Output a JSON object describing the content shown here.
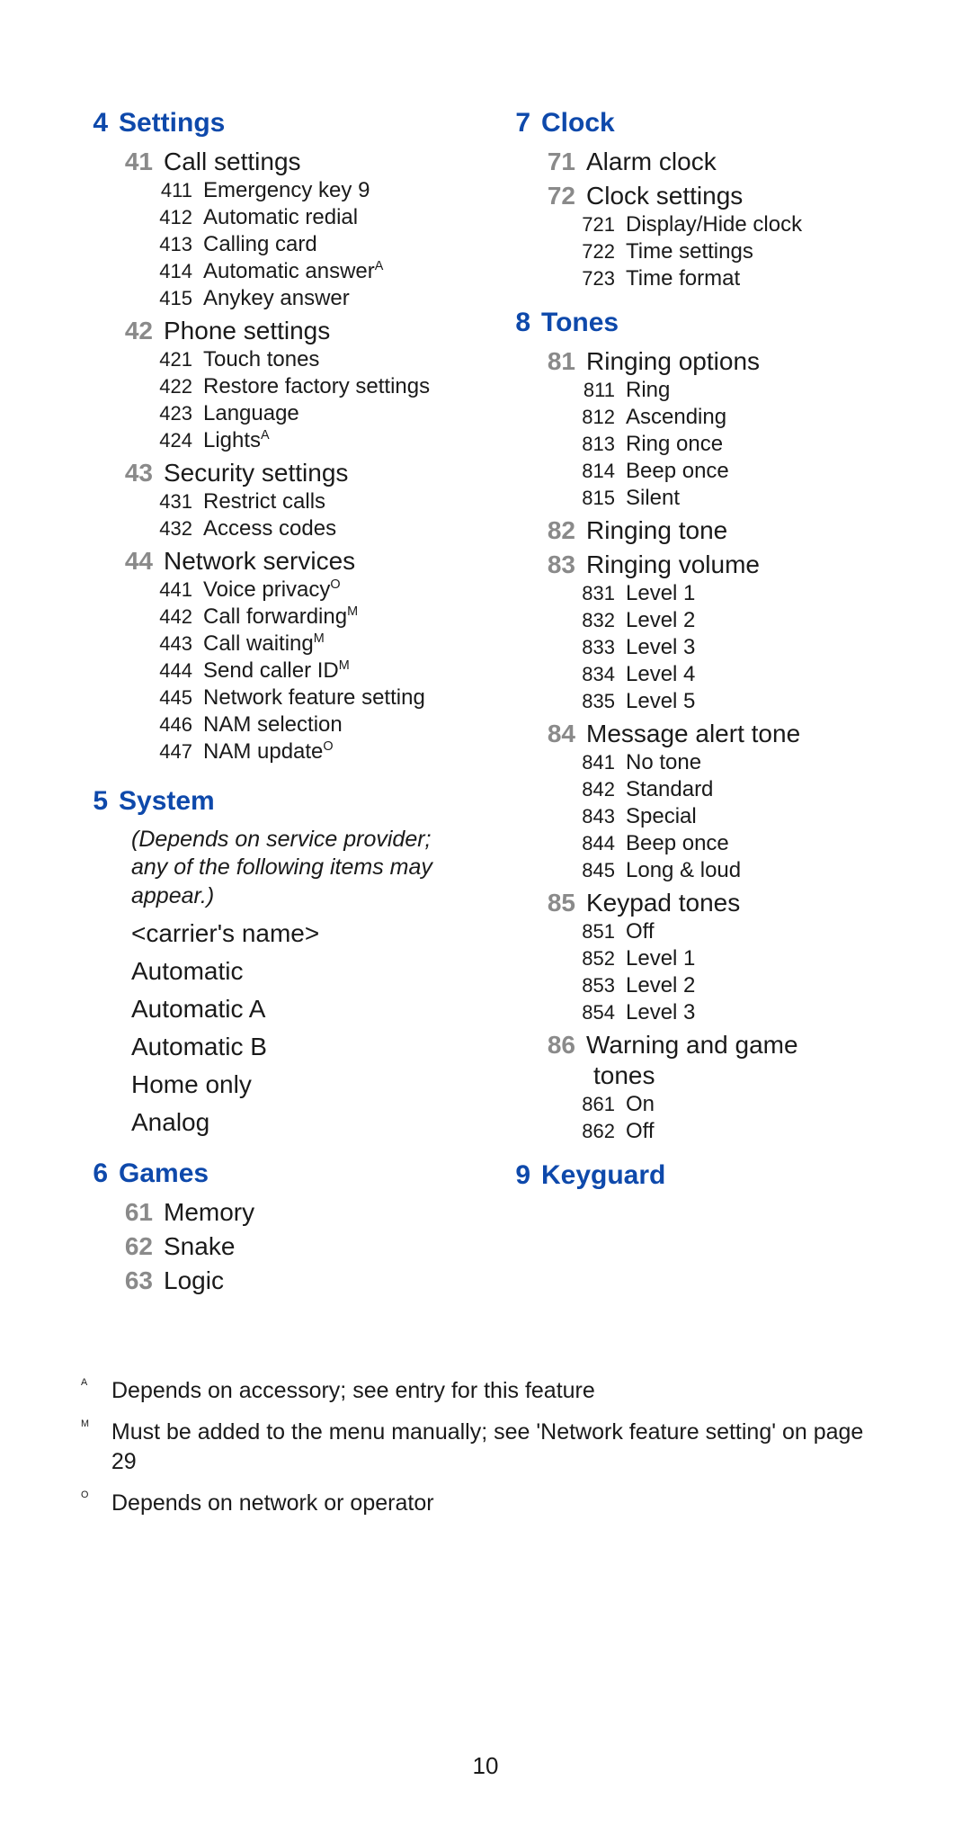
{
  "pageNumber": "10",
  "footnotes": {
    "A": {
      "marker": "A",
      "text": "Depends on accessory; see entry for this feature"
    },
    "M": {
      "marker": "M",
      "text": "Must be added to the menu manually; see 'Network feature setting' on page 29"
    },
    "O": {
      "marker": "O",
      "text": "Depends on network or operator"
    }
  },
  "sec4": {
    "num": "4",
    "title": "Settings",
    "s41": {
      "num": "41",
      "title": "Call settings",
      "i411": {
        "num": "411",
        "title": "Emergency key 9"
      },
      "i412": {
        "num": "412",
        "title": "Automatic redial"
      },
      "i413": {
        "num": "413",
        "title": "Calling card"
      },
      "i414": {
        "num": "414",
        "title": "Automatic answer",
        "sup": "A"
      },
      "i415": {
        "num": "415",
        "title": "Anykey answer"
      }
    },
    "s42": {
      "num": "42",
      "title": "Phone settings",
      "i421": {
        "num": "421",
        "title": "Touch tones"
      },
      "i422": {
        "num": "422",
        "title": "Restore factory settings"
      },
      "i423": {
        "num": "423",
        "title": "Language"
      },
      "i424": {
        "num": "424",
        "title": "Lights",
        "sup": "A"
      }
    },
    "s43": {
      "num": "43",
      "title": "Security settings",
      "i431": {
        "num": "431",
        "title": "Restrict calls"
      },
      "i432": {
        "num": "432",
        "title": "Access codes"
      }
    },
    "s44": {
      "num": "44",
      "title": "Network services",
      "i441": {
        "num": "441",
        "title": "Voice privacy",
        "sup": "O"
      },
      "i442": {
        "num": "442",
        "title": "Call forwarding",
        "sup": "M"
      },
      "i443": {
        "num": "443",
        "title": "Call waiting",
        "sup": "M"
      },
      "i444": {
        "num": "444",
        "title": "Send caller ID",
        "sup": "M"
      },
      "i445": {
        "num": "445",
        "title": "Network feature setting"
      },
      "i446": {
        "num": "446",
        "title": "NAM selection"
      },
      "i447": {
        "num": "447",
        "title": "NAM update",
        "sup": "O"
      }
    }
  },
  "sec5": {
    "num": "5",
    "title": "System",
    "note": "(Depends on service provider; any of the following items may appear.)",
    "opts": {
      "a": "<carrier's name>",
      "b": "Automatic",
      "c": "Automatic A",
      "d": "Automatic B",
      "e": "Home only",
      "f": "Analog"
    }
  },
  "sec6": {
    "num": "6",
    "title": "Games",
    "s61": {
      "num": "61",
      "title": "Memory"
    },
    "s62": {
      "num": "62",
      "title": "Snake"
    },
    "s63": {
      "num": "63",
      "title": "Logic"
    }
  },
  "sec7": {
    "num": "7",
    "title": "Clock",
    "s71": {
      "num": "71",
      "title": "Alarm clock"
    },
    "s72": {
      "num": "72",
      "title": "Clock settings",
      "i721": {
        "num": "721",
        "title": "Display/Hide clock"
      },
      "i722": {
        "num": "722",
        "title": "Time settings"
      },
      "i723": {
        "num": "723",
        "title": "Time format"
      }
    }
  },
  "sec8": {
    "num": "8",
    "title": "Tones",
    "s81": {
      "num": "81",
      "title": "Ringing options",
      "i811": {
        "num": "811",
        "title": "Ring"
      },
      "i812": {
        "num": "812",
        "title": "Ascending"
      },
      "i813": {
        "num": "813",
        "title": "Ring once"
      },
      "i814": {
        "num": "814",
        "title": "Beep once"
      },
      "i815": {
        "num": "815",
        "title": "Silent"
      }
    },
    "s82": {
      "num": "82",
      "title": "Ringing tone"
    },
    "s83": {
      "num": "83",
      "title": "Ringing volume",
      "i831": {
        "num": "831",
        "title": "Level 1"
      },
      "i832": {
        "num": "832",
        "title": "Level 2"
      },
      "i833": {
        "num": "833",
        "title": "Level 3"
      },
      "i834": {
        "num": "834",
        "title": "Level 4"
      },
      "i835": {
        "num": "835",
        "title": "Level 5"
      }
    },
    "s84": {
      "num": "84",
      "title": "Message alert tone",
      "i841": {
        "num": "841",
        "title": "No tone"
      },
      "i842": {
        "num": "842",
        "title": "Standard"
      },
      "i843": {
        "num": "843",
        "title": "Special"
      },
      "i844": {
        "num": "844",
        "title": "Beep once"
      },
      "i845": {
        "num": "845",
        "title": "Long & loud"
      }
    },
    "s85": {
      "num": "85",
      "title": "Keypad tones",
      "i851": {
        "num": "851",
        "title": "Off"
      },
      "i852": {
        "num": "852",
        "title": "Level 1"
      },
      "i853": {
        "num": "853",
        "title": "Level 2"
      },
      "i854": {
        "num": "854",
        "title": "Level 3"
      }
    },
    "s86": {
      "num": "86",
      "title": "Warning and game",
      "title2": "tones",
      "i861": {
        "num": "861",
        "title": "On"
      },
      "i862": {
        "num": "862",
        "title": "Off"
      }
    }
  },
  "sec9": {
    "num": "9",
    "title": "Keyguard"
  }
}
